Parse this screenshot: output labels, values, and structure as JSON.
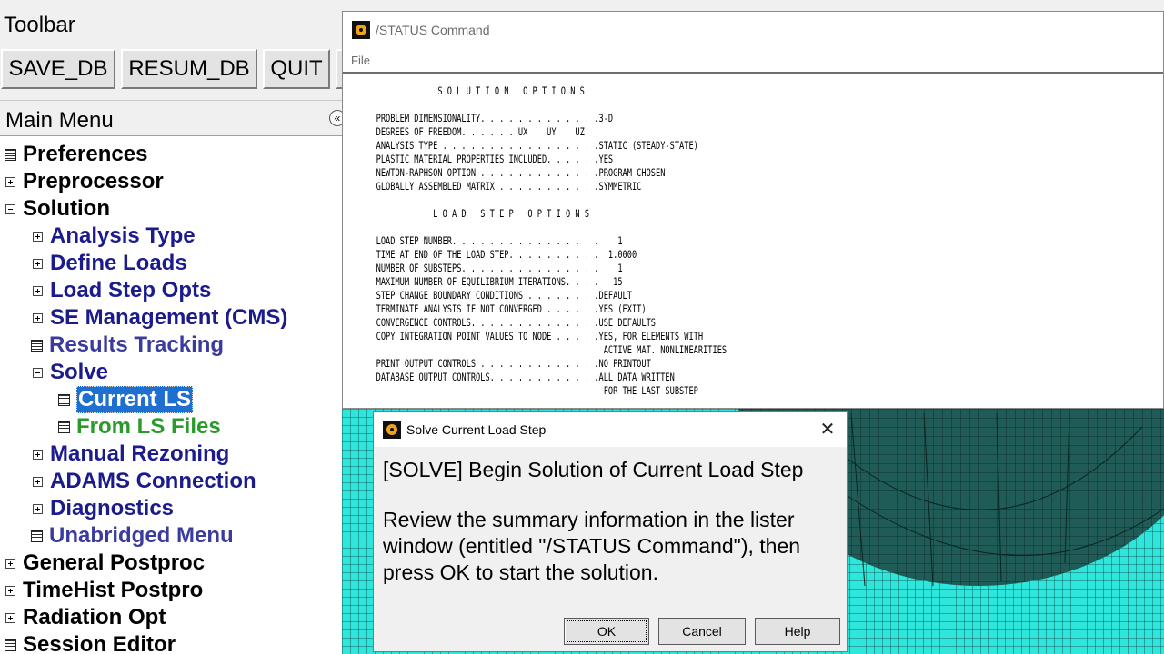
{
  "toolbar": {
    "title": "Toolbar",
    "buttons": {
      "save": "SAVE_DB",
      "resum": "RESUM_DB",
      "quit": "QUIT"
    }
  },
  "main_menu": {
    "title": "Main Menu",
    "items": [
      {
        "label": "Preferences"
      },
      {
        "label": "Preprocessor"
      },
      {
        "label": "Solution"
      },
      {
        "label": "Analysis Type"
      },
      {
        "label": "Define Loads"
      },
      {
        "label": "Load Step Opts"
      },
      {
        "label": "SE Management (CMS)"
      },
      {
        "label": "Results Tracking"
      },
      {
        "label": "Solve"
      },
      {
        "label": "Current LS"
      },
      {
        "label": "From LS Files"
      },
      {
        "label": "Manual Rezoning"
      },
      {
        "label": "ADAMS Connection"
      },
      {
        "label": "Diagnostics"
      },
      {
        "label": "Unabridged Menu"
      },
      {
        "label": "General Postproc"
      },
      {
        "label": "TimeHist Postpro"
      },
      {
        "label": "Radiation Opt"
      },
      {
        "label": "Session Editor"
      }
    ]
  },
  "status_window": {
    "title": "/STATUS  Command",
    "menu_file": "File",
    "lines": [
      "                S O L U T I O N   O P T I O N S",
      "",
      "   PROBLEM DIMENSIONALITY. . . . . . . . . . . . .3-D",
      "   DEGREES OF FREEDOM. . . . . . UX    UY    UZ",
      "   ANALYSIS TYPE . . . . . . . . . . . . . . . . .STATIC (STEADY-STATE)",
      "   PLASTIC MATERIAL PROPERTIES INCLUDED. . . . . .YES",
      "   NEWTON-RAPHSON OPTION . . . . . . . . . . . . .PROGRAM CHOSEN",
      "   GLOBALLY ASSEMBLED MATRIX . . . . . . . . . . .SYMMETRIC",
      "",
      "               L O A D   S T E P   O P T I O N S",
      "",
      "   LOAD STEP NUMBER. . . . . . . . . . . . . . . .    1",
      "   TIME AT END OF THE LOAD STEP. . . . . . . . . .  1.0000",
      "   NUMBER OF SUBSTEPS. . . . . . . . . . . . . . .    1",
      "   MAXIMUM NUMBER OF EQUILIBRIUM ITERATIONS. . . .   15",
      "   STEP CHANGE BOUNDARY CONDITIONS . . . . . . . .DEFAULT",
      "   TERMINATE ANALYSIS IF NOT CONVERGED . . . . . .YES (EXIT)",
      "   CONVERGENCE CONTROLS. . . . . . . . . . . . . .USE DEFAULTS",
      "   COPY INTEGRATION POINT VALUES TO NODE . . . . .YES, FOR ELEMENTS WITH",
      "                                                   ACTIVE MAT. NONLINEARITIES",
      "   PRINT OUTPUT CONTROLS . . . . . . . . . . . . .NO PRINTOUT",
      "   DATABASE OUTPUT CONTROLS. . . . . . . . . . . .ALL DATA WRITTEN",
      "                                                   FOR THE LAST SUBSTEP"
    ]
  },
  "dialog": {
    "title": "Solve Current Load Step",
    "heading": "[SOLVE] Begin Solution of Current Load Step",
    "body_lines": [
      "Review the summary information in the lister",
      "window (entitled  \"/STATUS Command\"), then",
      "press OK to start the solution."
    ],
    "buttons": {
      "ok": "OK",
      "cancel": "Cancel",
      "help": "Help"
    }
  },
  "colors": {
    "mesh_cyan": "#2ee6dc",
    "mesh_dark": "#1f5c57",
    "selection": "#1e6fd0",
    "menu_navy": "#1b1b8c",
    "menu_green": "#2a9a2a"
  }
}
